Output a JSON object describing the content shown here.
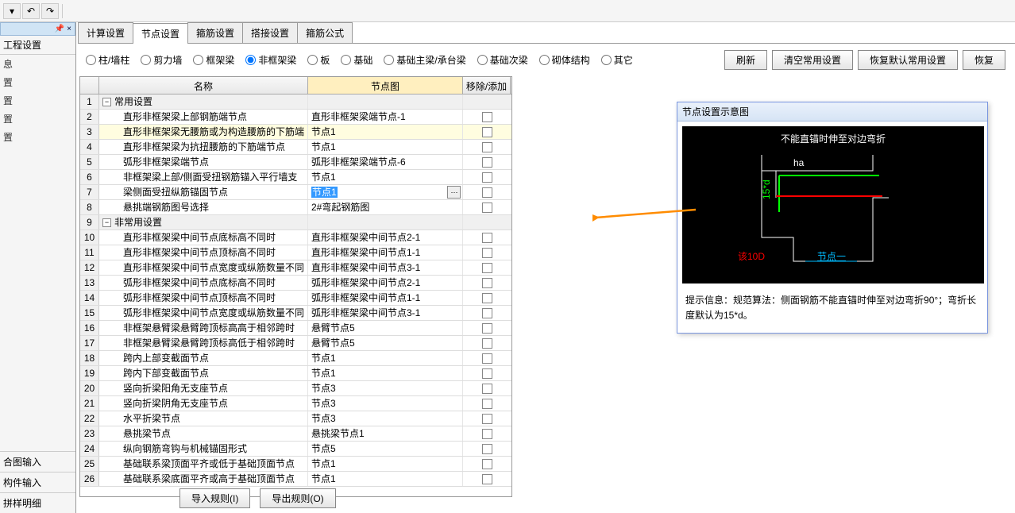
{
  "toolbar": {
    "save": "💾"
  },
  "sidebar": {
    "pin": "📌 ×",
    "title": "工程设置",
    "items": [
      "息",
      "置",
      "置",
      "置",
      "置"
    ],
    "foot": [
      "合图输入",
      "构件输入",
      "拼样明细"
    ]
  },
  "tabs": [
    "计算设置",
    "节点设置",
    "箍筋设置",
    "搭接设置",
    "箍筋公式"
  ],
  "active_tab": 1,
  "radios": [
    "柱/墙柱",
    "剪力墙",
    "框架梁",
    "非框架梁",
    "板",
    "基础",
    "基础主梁/承台梁",
    "基础次梁",
    "砌体结构",
    "其它"
  ],
  "radio_selected": 3,
  "buttons": {
    "refresh": "刷新",
    "clear": "清空常用设置",
    "restore": "恢复默认常用设置",
    "restore2": "恢复"
  },
  "grid": {
    "head": {
      "name": "名称",
      "fig": "节点图",
      "act": "移除/添加"
    },
    "rows": [
      {
        "n": 1,
        "grp": true,
        "name": "常用设置"
      },
      {
        "n": 2,
        "name": "直形非框架梁上部钢筋端节点",
        "fig": "直形非框架梁端节点-1"
      },
      {
        "n": 3,
        "hl": true,
        "name": "直形非框架梁无腰筋或为构造腰筋的下筋端",
        "fig": "节点1"
      },
      {
        "n": 4,
        "name": "直形非框架梁为抗扭腰筋的下筋端节点",
        "fig": "节点1"
      },
      {
        "n": 5,
        "name": "弧形非框架梁端节点",
        "fig": "弧形非框架梁端节点-6"
      },
      {
        "n": 6,
        "name": "非框架梁上部/侧面受扭钢筋锚入平行墙支",
        "fig": "节点1"
      },
      {
        "n": 7,
        "sel": true,
        "name": "梁侧面受扭纵筋锚固节点",
        "fig": "节点1"
      },
      {
        "n": 8,
        "name": "悬挑端钢筋图号选择",
        "fig": "2#弯起钢筋图"
      },
      {
        "n": 9,
        "grp": true,
        "name": "非常用设置"
      },
      {
        "n": 10,
        "name": "直形非框架梁中间节点底标高不同时",
        "fig": "直形非框架梁中间节点2-1"
      },
      {
        "n": 11,
        "name": "直形非框架梁中间节点顶标高不同时",
        "fig": "直形非框架梁中间节点1-1"
      },
      {
        "n": 12,
        "name": "直形非框架梁中间节点宽度或纵筋数量不同",
        "fig": "直形非框架梁中间节点3-1"
      },
      {
        "n": 13,
        "name": "弧形非框架梁中间节点底标高不同时",
        "fig": "弧形非框架梁中间节点2-1"
      },
      {
        "n": 14,
        "name": "弧形非框架梁中间节点顶标高不同时",
        "fig": "弧形非框架梁中间节点1-1"
      },
      {
        "n": 15,
        "name": "弧形非框架梁中间节点宽度或纵筋数量不同",
        "fig": "弧形非框架梁中间节点3-1"
      },
      {
        "n": 16,
        "name": "非框架悬臂梁悬臂跨顶标高高于相邻跨时",
        "fig": "悬臂节点5"
      },
      {
        "n": 17,
        "name": "非框架悬臂梁悬臂跨顶标高低于相邻跨时",
        "fig": "悬臂节点5"
      },
      {
        "n": 18,
        "name": "跨内上部变截面节点",
        "fig": "节点1"
      },
      {
        "n": 19,
        "name": "跨内下部变截面节点",
        "fig": "节点1"
      },
      {
        "n": 20,
        "name": "竖向折梁阳角无支座节点",
        "fig": "节点3"
      },
      {
        "n": 21,
        "name": "竖向折梁阴角无支座节点",
        "fig": "节点3"
      },
      {
        "n": 22,
        "name": "水平折梁节点",
        "fig": "节点3"
      },
      {
        "n": 23,
        "name": "悬挑梁节点",
        "fig": "悬挑梁节点1"
      },
      {
        "n": 24,
        "name": "纵向钢筋弯钩与机械锚固形式",
        "fig": "节点5"
      },
      {
        "n": 25,
        "name": "基础联系梁顶面平齐或低于基础顶面节点",
        "fig": "节点1"
      },
      {
        "n": 26,
        "name": "基础联系梁底面平齐或高于基础顶面节点",
        "fig": "节点1"
      }
    ]
  },
  "footer": {
    "import": "导入规则(I)",
    "export": "导出规则(O)"
  },
  "diagram": {
    "title": "节点设置示意图",
    "toptext": "不能直锚时伸至对边弯折",
    "ha": "ha",
    "dim": "15*d",
    "d10": "该10D",
    "node": "节点一",
    "info_label": "提示信息：",
    "info": "规范算法：侧面钢筋不能直锚时伸至对边弯折90°；弯折长度默认为15*d。"
  }
}
